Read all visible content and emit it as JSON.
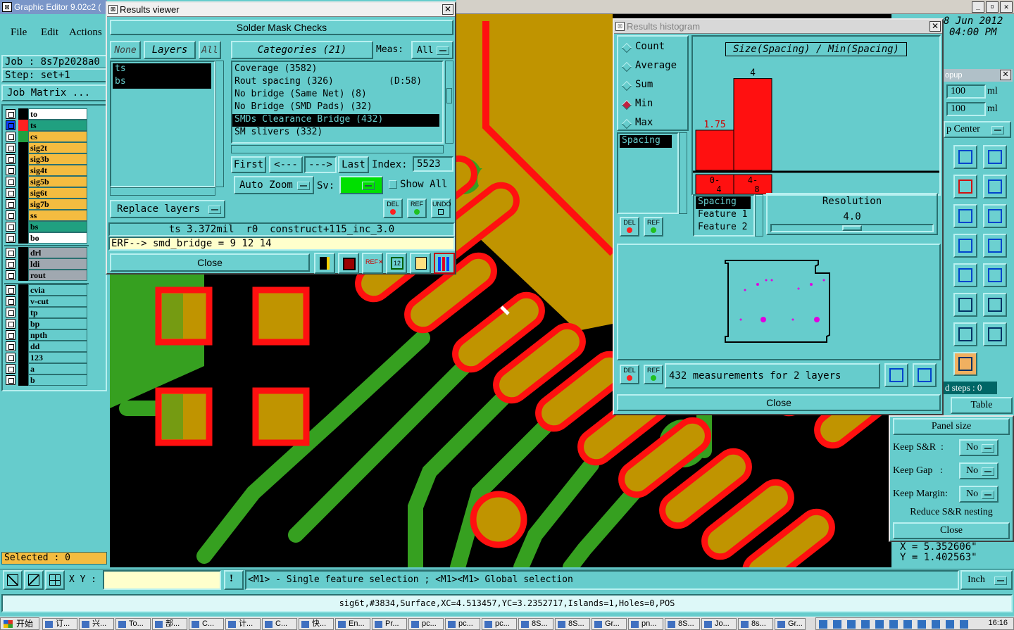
{
  "main": {
    "title": "Graphic Editor 9.02c2 (",
    "date": "8 Jun 2012",
    "time": "04:00 PM",
    "menu": [
      "File",
      "Edit",
      "Actions"
    ],
    "job_label": "Job : 8s7p2028a0",
    "step_label": "Step: set+1",
    "job_matrix": "Job Matrix ...",
    "selected": "Selected : 0",
    "xy_label": "X Y :",
    "xy_value": "",
    "hint": "<M1> - Single feature selection ; <M1><M1> Global selection",
    "units": "Inch",
    "status": "sig6t,#3834,Surface,XC=4.513457,YC=3.2352717,Islands=1,Holes=0,POS",
    "coord_x": "X = 5.352606\"",
    "coord_y": "Y = 1.402563\"",
    "clock": "16:16",
    "start": "开始"
  },
  "layers": [
    {
      "name": "to",
      "color": "wm"
    },
    {
      "name": "ts",
      "color": "gm",
      "swatch": "#ff2020",
      "active": true
    },
    {
      "name": "cs",
      "color": "ym",
      "swatch": "#20a040"
    },
    {
      "name": "sig2t",
      "color": "ym"
    },
    {
      "name": "sig3b",
      "color": "ym"
    },
    {
      "name": "sig4t",
      "color": "ym"
    },
    {
      "name": "sig5b",
      "color": "ym"
    },
    {
      "name": "sig6t",
      "color": "ym"
    },
    {
      "name": "sig7b",
      "color": "ym"
    },
    {
      "name": "ss",
      "color": "ym"
    },
    {
      "name": "bs",
      "color": "gm"
    },
    {
      "name": "bo",
      "color": "wm"
    }
  ],
  "layers2": [
    {
      "name": "drl",
      "color": "grm"
    },
    {
      "name": "ldi",
      "color": "grm"
    },
    {
      "name": "rout",
      "color": "grm"
    }
  ],
  "layers3": [
    {
      "name": "cvia",
      "color": "cym"
    },
    {
      "name": "v-cut",
      "color": "cym"
    },
    {
      "name": "tp",
      "color": "cym"
    },
    {
      "name": "bp",
      "color": "cym"
    },
    {
      "name": "npth",
      "color": "cym"
    },
    {
      "name": "dd",
      "color": "cym"
    },
    {
      "name": "123",
      "color": "cym"
    },
    {
      "name": "a",
      "color": "cym"
    },
    {
      "name": "b",
      "color": "cym"
    }
  ],
  "results": {
    "title": "Results viewer",
    "header": "Solder Mask Checks",
    "none": "None",
    "layers_tab": "Layers",
    "all": "All",
    "categories_tab": "Categories (21)",
    "meas_label": "Meas:",
    "meas_value": "All",
    "layer_items": [
      "ts",
      "bs"
    ],
    "categories": [
      "Coverage (3582)",
      "Rout spacing (326)          (D:58)",
      "No bridge (Same Net) (8)",
      "No Bridge (SMD Pads) (32)",
      "SMDs Clearance Bridge (432)",
      "SM slivers (332)"
    ],
    "first": "First",
    "prev": "<---",
    "next": "--->",
    "last": "Last",
    "index_label": "Index:",
    "index_value": "5523",
    "auto_zoom": "Auto Zoom",
    "sv_label": "Sv:",
    "show_all": "Show All",
    "replace_layers": "Replace layers",
    "del": "DEL",
    "ref": "REF",
    "undo": "UNDO",
    "info": "ts 3.372mil  r0  construct+115_inc_3.0",
    "erf": "ERF--> smd_bridge = 9 12 14",
    "close": "Close"
  },
  "histogram": {
    "title": "Results histogram",
    "options": [
      "Count",
      "Average",
      "Sum",
      "Min",
      "Max"
    ],
    "selected_option": "Min",
    "chart_title": "Size(Spacing) / Min(Spacing)",
    "measure_items": [
      "Spacing"
    ],
    "feature_items": [
      "Spacing",
      "Feature 1",
      "Feature 2"
    ],
    "resolution_label": "Resolution",
    "resolution_value": "4.0",
    "resolution_fraction": 0.5,
    "summary": "432 measurements for 2 layers",
    "close": "Close"
  },
  "chart_data": {
    "type": "bar",
    "categories": [
      "0-4",
      "4-8"
    ],
    "values": [
      1.75,
      4
    ],
    "data_labels": [
      "1.75",
      "4"
    ],
    "title": "Size(Spacing) / Min(Spacing)",
    "ylim": [
      0,
      4.6
    ],
    "colors": {
      "bar": "#ff1010",
      "label": "#cc0000"
    }
  },
  "popup": {
    "title": "opup",
    "val1": "100",
    "unit1": "ml",
    "val2": "100",
    "unit2": "ml",
    "center": "p Center",
    "steps": "d steps : 0",
    "table": "Table",
    "panel_size": "Panel size",
    "keep_sr": "Keep S&R  :",
    "keep_gap": "Keep Gap   :",
    "keep_margin": "Keep Margin:",
    "no": "No",
    "reduce": "Reduce S&R nesting",
    "close": "Close"
  },
  "taskbar": [
    "订...",
    "兴...",
    "To...",
    "部...",
    "C...",
    "计...",
    "C...",
    "快...",
    "En...",
    "Pr...",
    "pc...",
    "pc...",
    "pc...",
    "8S...",
    "8S...",
    "Gr...",
    "pn...",
    "8S...",
    "Jo...",
    "8s...",
    "Gr..."
  ]
}
